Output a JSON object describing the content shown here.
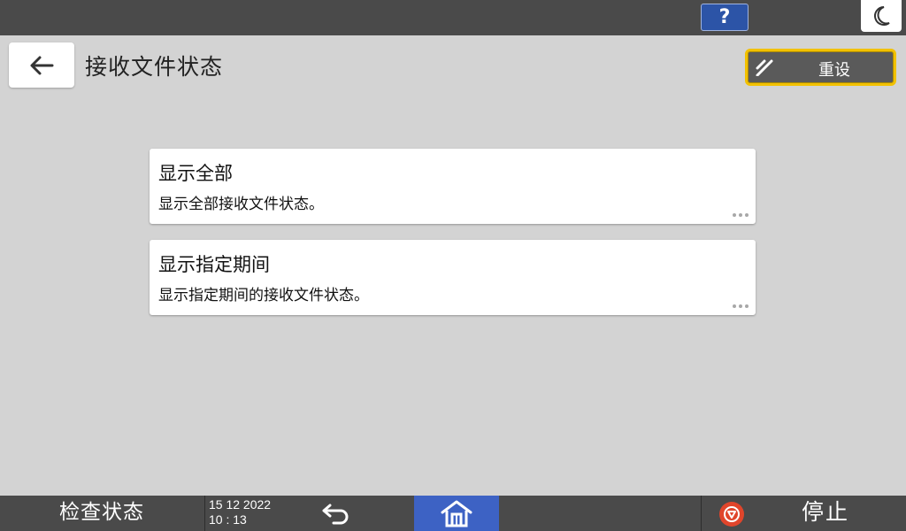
{
  "topbar": {
    "help_label": "?",
    "help_icon": "question-icon",
    "sleep_icon": "moon-icon"
  },
  "header": {
    "back_icon": "arrow-left-icon",
    "title": "接收文件状态",
    "reset_label": "重设",
    "reset_icon": "reset-slash-icon"
  },
  "options": [
    {
      "title": "显示全部",
      "description": "显示全部接收文件状态。"
    },
    {
      "title": "显示指定期间",
      "description": "显示指定期间的接收文件状态。"
    }
  ],
  "bottombar": {
    "status_label": "检查状态",
    "date": "15 12 2022",
    "time": "10 : 13",
    "back_icon": "undo-arrow-icon",
    "home_icon": "home-icon",
    "stop_icon": "stop-icon",
    "stop_label": "停止"
  },
  "colors": {
    "background": "#d3d3d3",
    "bar": "#4a4a4a",
    "accent_blue": "#3d62c4",
    "reset_border": "#f2c100",
    "stop_red": "#e0452b"
  }
}
